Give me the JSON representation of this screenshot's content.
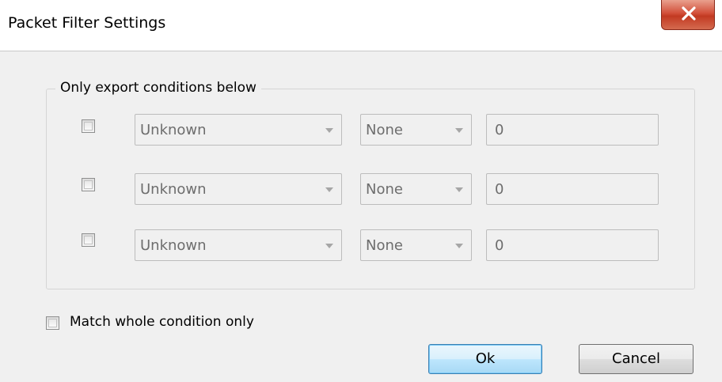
{
  "window": {
    "title": "Packet Filter Settings",
    "close_glyph": "X"
  },
  "group": {
    "legend": "Only export conditions below"
  },
  "conditions": [
    {
      "checked": false,
      "field": "Unknown",
      "operator": "None",
      "value": "0"
    },
    {
      "checked": false,
      "field": "Unknown",
      "operator": "None",
      "value": "0"
    },
    {
      "checked": false,
      "field": "Unknown",
      "operator": "None",
      "value": "0"
    }
  ],
  "match_whole": {
    "label": "Match whole condition only",
    "checked": false
  },
  "buttons": {
    "ok_label": "Ok",
    "cancel_label": "Cancel"
  },
  "icons": {
    "close": "close-icon",
    "combo_arrow": "chevron-down-icon"
  }
}
